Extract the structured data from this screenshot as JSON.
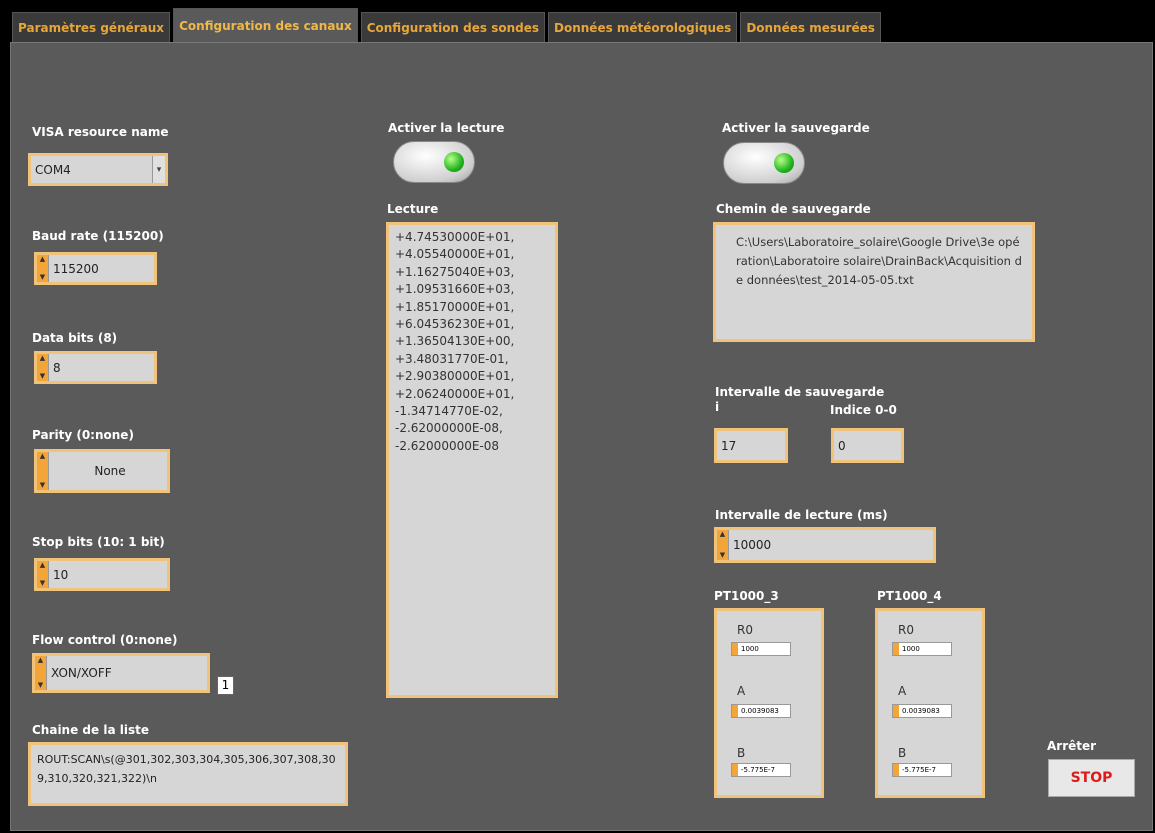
{
  "tabs": [
    {
      "label": "Paramètres généraux"
    },
    {
      "label": "Configuration des canaux"
    },
    {
      "label": "Configuration des sondes"
    },
    {
      "label": "Données météorologiques"
    },
    {
      "label": "Données mesurées"
    }
  ],
  "visa": {
    "label": "VISA resource name",
    "value": "COM4"
  },
  "baud": {
    "label": "Baud rate (115200)",
    "value": "115200"
  },
  "databits": {
    "label": "Data bits (8)",
    "value": "8"
  },
  "parity": {
    "label": "Parity (0:none)",
    "value": "None"
  },
  "stopbits": {
    "label": "Stop bits (10: 1 bit)",
    "value": "10"
  },
  "flow": {
    "label": "Flow control (0:none)",
    "value": "XON/XOFF",
    "index": "1"
  },
  "chaine": {
    "label": "Chaine de la liste",
    "value": "ROUT:SCAN\\s(@301,302,303,304,305,306,307,308,309,310,320,321,322)\\n"
  },
  "lecture_toggle": {
    "label": "Activer la lecture"
  },
  "sauvegarde_toggle": {
    "label": "Activer la sauvegarde"
  },
  "lecture": {
    "label": "Lecture",
    "values": [
      "+4.74530000E+01,",
      "+4.05540000E+01,",
      "+1.16275040E+03,",
      "+1.09531660E+03,",
      "+1.85170000E+01,",
      "+6.04536230E+01,",
      "+1.36504130E+00,",
      "+3.48031770E-01,",
      "+2.90380000E+01,",
      "+2.06240000E+01,",
      "-1.34714770E-02,",
      "-2.62000000E-08,",
      "-2.62000000E-08"
    ]
  },
  "chemin": {
    "label": "Chemin de sauvegarde",
    "value": "C:\\Users\\Laboratoire_solaire\\Google Drive\\3e opération\\Laboratoire solaire\\DrainBack\\Acquisition de données\\test_2014-05-05.txt"
  },
  "intervalle_sauvegarde": {
    "label": "Intervalle de sauvegarde",
    "sublabel": "i",
    "value": "17"
  },
  "indice": {
    "label": "Indice 0-0",
    "value": "0"
  },
  "intervalle_lecture": {
    "label": "Intervalle de lecture (ms)",
    "value": "10000"
  },
  "pt1000_3": {
    "label": "PT1000_3",
    "r0_label": "R0",
    "r0": "1000",
    "a_label": "A",
    "a": "0.0039083",
    "b_label": "B",
    "b": "-5.775E-7"
  },
  "pt1000_4": {
    "label": "PT1000_4",
    "r0_label": "R0",
    "r0": "1000",
    "a_label": "A",
    "a": "0.0039083",
    "b_label": "B",
    "b": "-5.775E-7"
  },
  "stop": {
    "label": "Arrêter",
    "button": "STOP"
  }
}
